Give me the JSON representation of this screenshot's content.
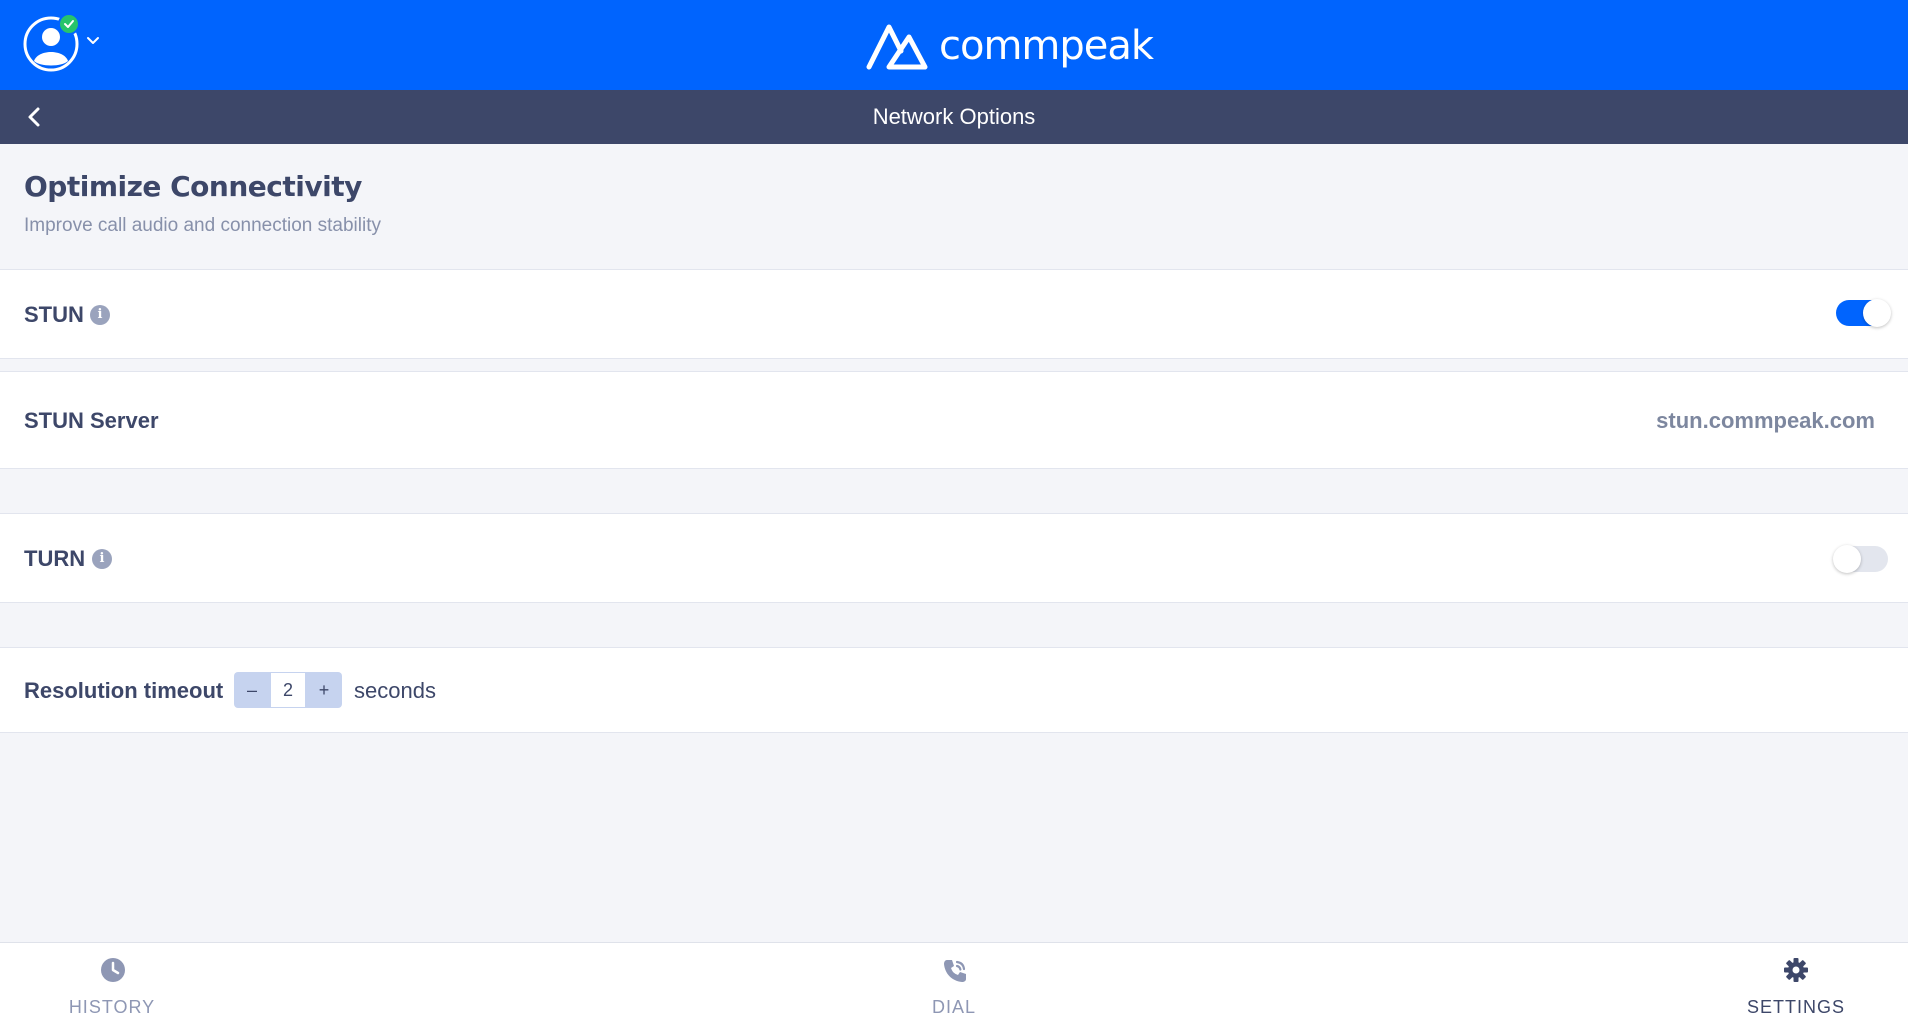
{
  "app": {
    "brand": "commpeak",
    "colors": {
      "primary": "#0064fe",
      "header_dark": "#3d4769",
      "status_online": "#27c46b",
      "background": "#f4f5f9"
    }
  },
  "topbar": {
    "avatar_icon": "user-avatar-icon",
    "status_icon": "check-icon",
    "menu_icon": "chevron-down-icon"
  },
  "subheader": {
    "back_icon": "chevron-left-icon",
    "title": "Network Options"
  },
  "section": {
    "title": "Optimize Connectivity",
    "subtitle": "Improve call audio and connection stability"
  },
  "settings": {
    "stun": {
      "label": "STUN",
      "info_icon": "info-icon",
      "info_glyph": "i",
      "enabled": true
    },
    "stun_server": {
      "label": "STUN Server",
      "value": "stun.commpeak.com"
    },
    "turn": {
      "label": "TURN",
      "info_icon": "info-icon",
      "info_glyph": "i",
      "enabled": false
    },
    "resolution_timeout": {
      "label": "Resolution timeout",
      "minus_label": "–",
      "value": "2",
      "plus_label": "+",
      "unit": "seconds"
    }
  },
  "tabs": [
    {
      "label": "HISTORY",
      "icon": "clock-icon",
      "active": false
    },
    {
      "label": "DIAL",
      "icon": "phone-icon",
      "active": false
    },
    {
      "label": "SETTINGS",
      "icon": "gear-icon",
      "active": true
    }
  ]
}
